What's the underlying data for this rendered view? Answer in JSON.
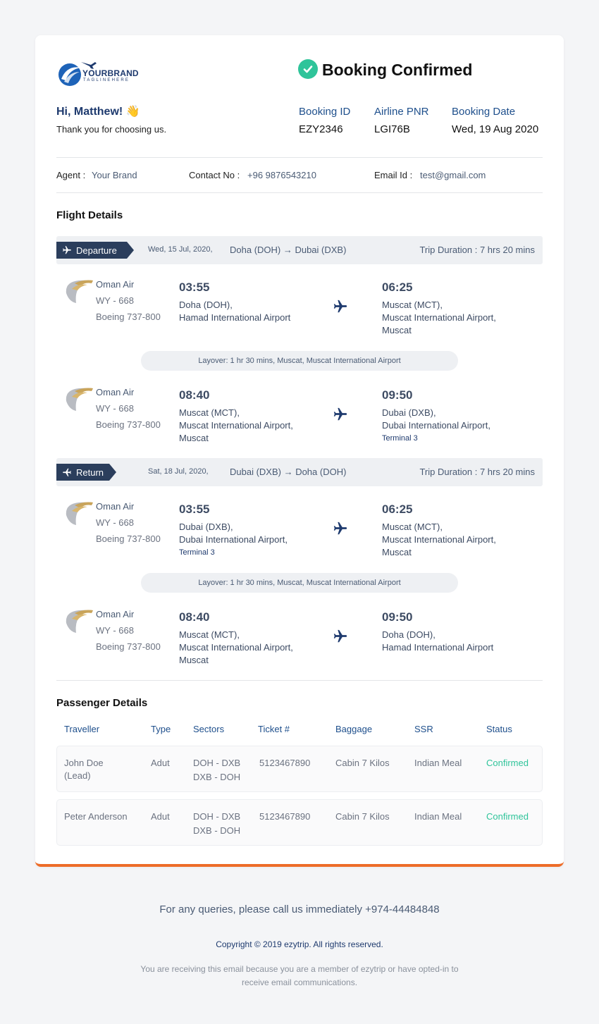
{
  "brand": {
    "name": "YOURBRAND",
    "tagline": "TAGLINEHERE"
  },
  "header": {
    "title": "Booking Confirmed",
    "greeting": "Hi, Matthew! 👋",
    "thanks": "Thank you for choosing us.",
    "booking_id_label": "Booking ID",
    "booking_id": "EZY2346",
    "pnr_label": "Airline PNR",
    "pnr": "LGI76B",
    "date_label": "Booking Date",
    "date": "Wed, 19 Aug 2020"
  },
  "contact": {
    "agent_label": "Agent :",
    "agent": "Your Brand",
    "phone_label": "Contact No :",
    "phone": "+96 9876543210",
    "email_label": "Email Id :",
    "email": "test@gmail.com"
  },
  "flight_details_title": "Flight Details",
  "trips": [
    {
      "tag": "Departure",
      "date": "Wed, 15 Jul, 2020,",
      "route": "Doha (DOH) → Dubai (DXB)",
      "duration": "Trip Duration : 7 hrs 20 mins",
      "segments": [
        {
          "airline": "Oman Air",
          "flight": "WY - 668",
          "aircraft": "Boeing 737-800",
          "dep_time": "03:55",
          "dep_line1": "Doha (DOH),",
          "dep_line2": "Hamad International Airport",
          "dep_line3": "",
          "arr_time": "06:25",
          "arr_line1": "Muscat (MCT),",
          "arr_line2": "Muscat International Airport,",
          "arr_line3": "Muscat"
        },
        {
          "airline": "Oman Air",
          "flight": "WY - 668",
          "aircraft": "Boeing 737-800",
          "dep_time": "08:40",
          "dep_line1": "Muscat (MCT),",
          "dep_line2": "Muscat International Airport,",
          "dep_line3": "Muscat",
          "arr_time": "09:50",
          "arr_line1": "Dubai (DXB),",
          "arr_line2": "Dubai International Airport,",
          "arr_line3": "Terminal 3"
        }
      ],
      "layover": "Layover: 1 hr 30 mins, Muscat, Muscat International Airport"
    },
    {
      "tag": "Return",
      "date": "Sat, 18 Jul, 2020,",
      "route": "Dubai (DXB) → Doha (DOH)",
      "duration": "Trip Duration : 7 hrs 20 mins",
      "segments": [
        {
          "airline": "Oman Air",
          "flight": "WY - 668",
          "aircraft": "Boeing 737-800",
          "dep_time": "03:55",
          "dep_line1": "Dubai (DXB),",
          "dep_line2": "Dubai International Airport,",
          "dep_line3": "Terminal 3",
          "arr_time": "06:25",
          "arr_line1": "Muscat (MCT),",
          "arr_line2": "Muscat International Airport,",
          "arr_line3": "Muscat"
        },
        {
          "airline": "Oman Air",
          "flight": "WY - 668",
          "aircraft": "Boeing 737-800",
          "dep_time": "08:40",
          "dep_line1": "Muscat (MCT),",
          "dep_line2": "Muscat International Airport,",
          "dep_line3": "Muscat",
          "arr_time": "09:50",
          "arr_line1": "Doha (DOH),",
          "arr_line2": "Hamad International Airport",
          "arr_line3": ""
        }
      ],
      "layover": "Layover: 1 hr 30 mins, Muscat, Muscat International Airport"
    }
  ],
  "passengers": {
    "title": "Passenger Details",
    "columns": [
      "Traveller",
      "Type",
      "Sectors",
      "Ticket #",
      "Baggage",
      "SSR",
      "Status"
    ],
    "rows": [
      {
        "name1": "John Doe",
        "name2": "(Lead)",
        "type": "Adut",
        "sector1": "DOH - DXB",
        "sector2": "DXB - DOH",
        "ticket": "5123467890",
        "baggage": "Cabin 7 Kilos",
        "ssr": "Indian Meal",
        "status": "Confirmed"
      },
      {
        "name1": "Peter Anderson",
        "name2": "",
        "type": "Adut",
        "sector1": "DOH - DXB",
        "sector2": "DXB - DOH",
        "ticket": "5123467890",
        "baggage": "Cabin 7 Kilos",
        "ssr": "Indian Meal",
        "status": "Confirmed"
      }
    ]
  },
  "footer": {
    "queries": "For any queries, please call us immediately +974-44484848",
    "copyright": "Copyright © 2019 ezytrip. All rights reserved.",
    "notice": "You are receiving this email because you are a member of ezytrip or have opted-in to receive email communications."
  },
  "colors": {
    "accent_orange": "#ed6c28",
    "success_green": "#2fc49a",
    "navy": "#1e3a6e",
    "tag_bg": "#2b3e5c"
  }
}
